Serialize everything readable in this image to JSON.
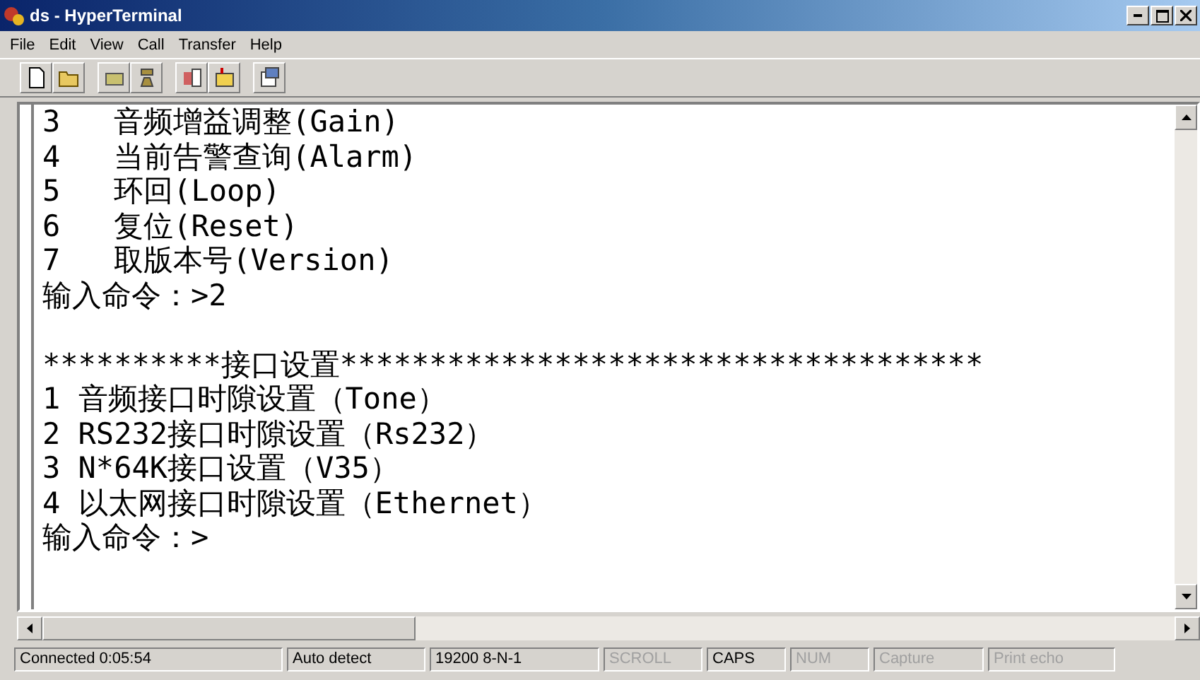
{
  "window": {
    "title": "ds - HyperTerminal"
  },
  "menu": [
    "File",
    "Edit",
    "View",
    "Call",
    "Transfer",
    "Help"
  ],
  "terminal": {
    "blocks": [
      {
        "lines": [
          "3   音频增益调整(Gain)",
          "4   当前告警查询(Alarm)",
          "5   环回(Loop)",
          "6   复位(Reset)",
          "7   取版本号(Version)",
          "输入命令：>2"
        ]
      },
      {
        "lines": [
          "**********接口设置************************************",
          "1 音频接口时隙设置（Tone）",
          "2 RS232接口时隙设置（Rs232）",
          "3 N*64K接口设置（V35）",
          "4 以太网接口时隙设置（Ethernet）",
          "输入命令：>"
        ]
      }
    ]
  },
  "status_bar": [
    {
      "text": "Connected 0:05:54",
      "disabled": false
    },
    {
      "text": "Auto detect",
      "disabled": false
    },
    {
      "text": "19200 8-N-1",
      "disabled": false
    },
    {
      "text": "SCROLL",
      "disabled": true
    },
    {
      "text": "CAPS",
      "disabled": false
    },
    {
      "text": "NUM",
      "disabled": true
    },
    {
      "text": "Capture",
      "disabled": true
    },
    {
      "text": "Print echo",
      "disabled": true
    }
  ]
}
